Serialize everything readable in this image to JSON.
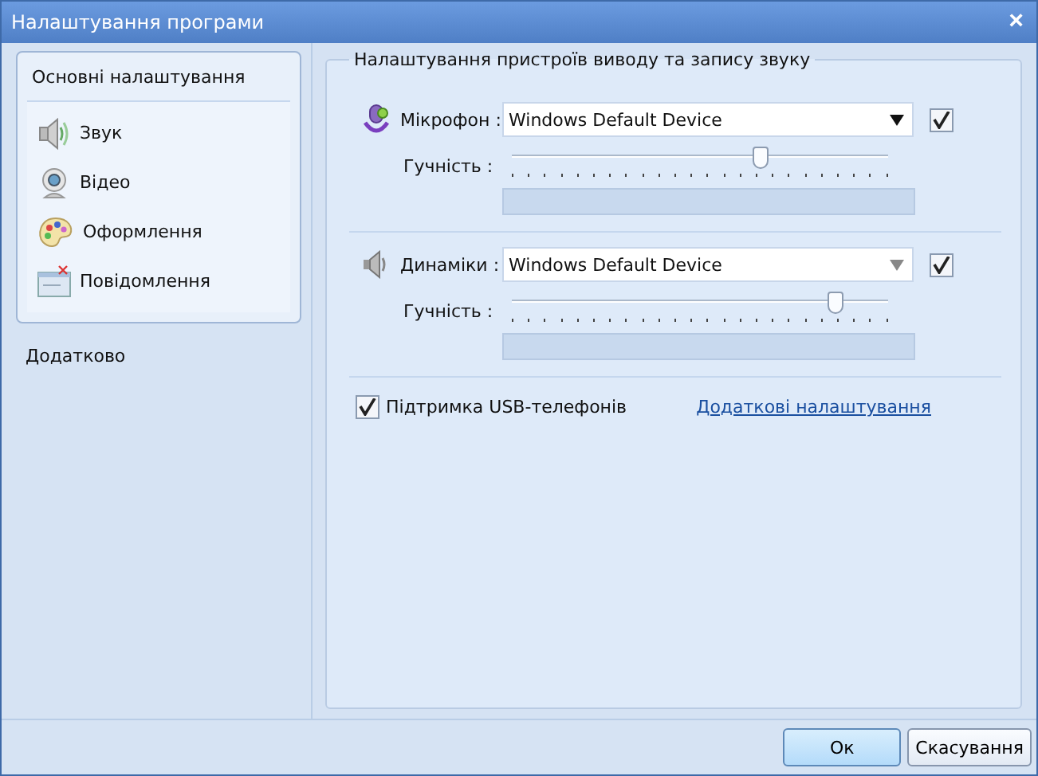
{
  "window": {
    "title": "Налаштування програми",
    "close": "×"
  },
  "sidebar": {
    "group_title": "Основні налаштування",
    "items": [
      {
        "label": "Звук",
        "kind": "sound",
        "selected": false
      },
      {
        "label": "Відео",
        "kind": "video",
        "selected": false
      },
      {
        "label": "Оформлення",
        "kind": "appearance",
        "selected": false
      },
      {
        "label": "Повідомлення",
        "kind": "messages",
        "selected": false
      }
    ],
    "extra": "Додатково"
  },
  "group": {
    "title": "Налаштування пристроїв виводу та запису звуку"
  },
  "devices": [
    {
      "kind": "microphone",
      "label": "Мікрофон :",
      "device": "Windows Default Device",
      "enabled": true,
      "volume_label": "Гучність :",
      "level": 0.66
    },
    {
      "kind": "speaker",
      "label": "Динаміки :",
      "device": "Windows Default Device",
      "enabled": true,
      "volume_label": "Гучність :",
      "level": 0.86
    }
  ],
  "usb_support": {
    "label": "Підтримка USB-телефонів",
    "checked": true
  },
  "advanced_link": "Додаткові налаштування",
  "buttons": [
    {
      "label": "Ок",
      "default": true
    },
    {
      "label": "Скасування",
      "default": false
    }
  ]
}
